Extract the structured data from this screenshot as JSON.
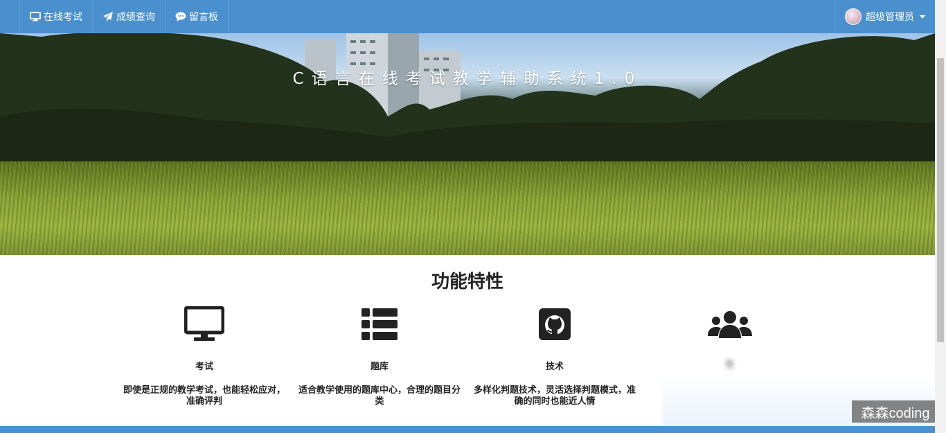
{
  "nav": {
    "items": [
      {
        "label": "在线考试",
        "icon": "monitor-icon"
      },
      {
        "label": "成绩查询",
        "icon": "paper-plane-icon"
      },
      {
        "label": "留言板",
        "icon": "comment-icon"
      }
    ],
    "user": {
      "name": "超级管理员",
      "icon": "caret-down-icon"
    },
    "bar_color": "#4a90cf"
  },
  "hero": {
    "title": "C语言在线考试教学辅助系统1.0"
  },
  "features": {
    "title": "功能特性",
    "items": [
      {
        "icon": "desktop-icon",
        "name": "考试",
        "desc": "即使是正规的教学考试，也能轻松应对，准确评判"
      },
      {
        "icon": "list-icon",
        "name": "题库",
        "desc": "适合教学使用的题库中心，合理的题目分类"
      },
      {
        "icon": "github-icon",
        "name": "技术",
        "desc": "多样化判题技术，灵活选择判题模式，准确的同时也能近人情"
      },
      {
        "icon": "users-icon",
        "name": "",
        "desc": "在"
      }
    ]
  },
  "watermark": "森森coding"
}
